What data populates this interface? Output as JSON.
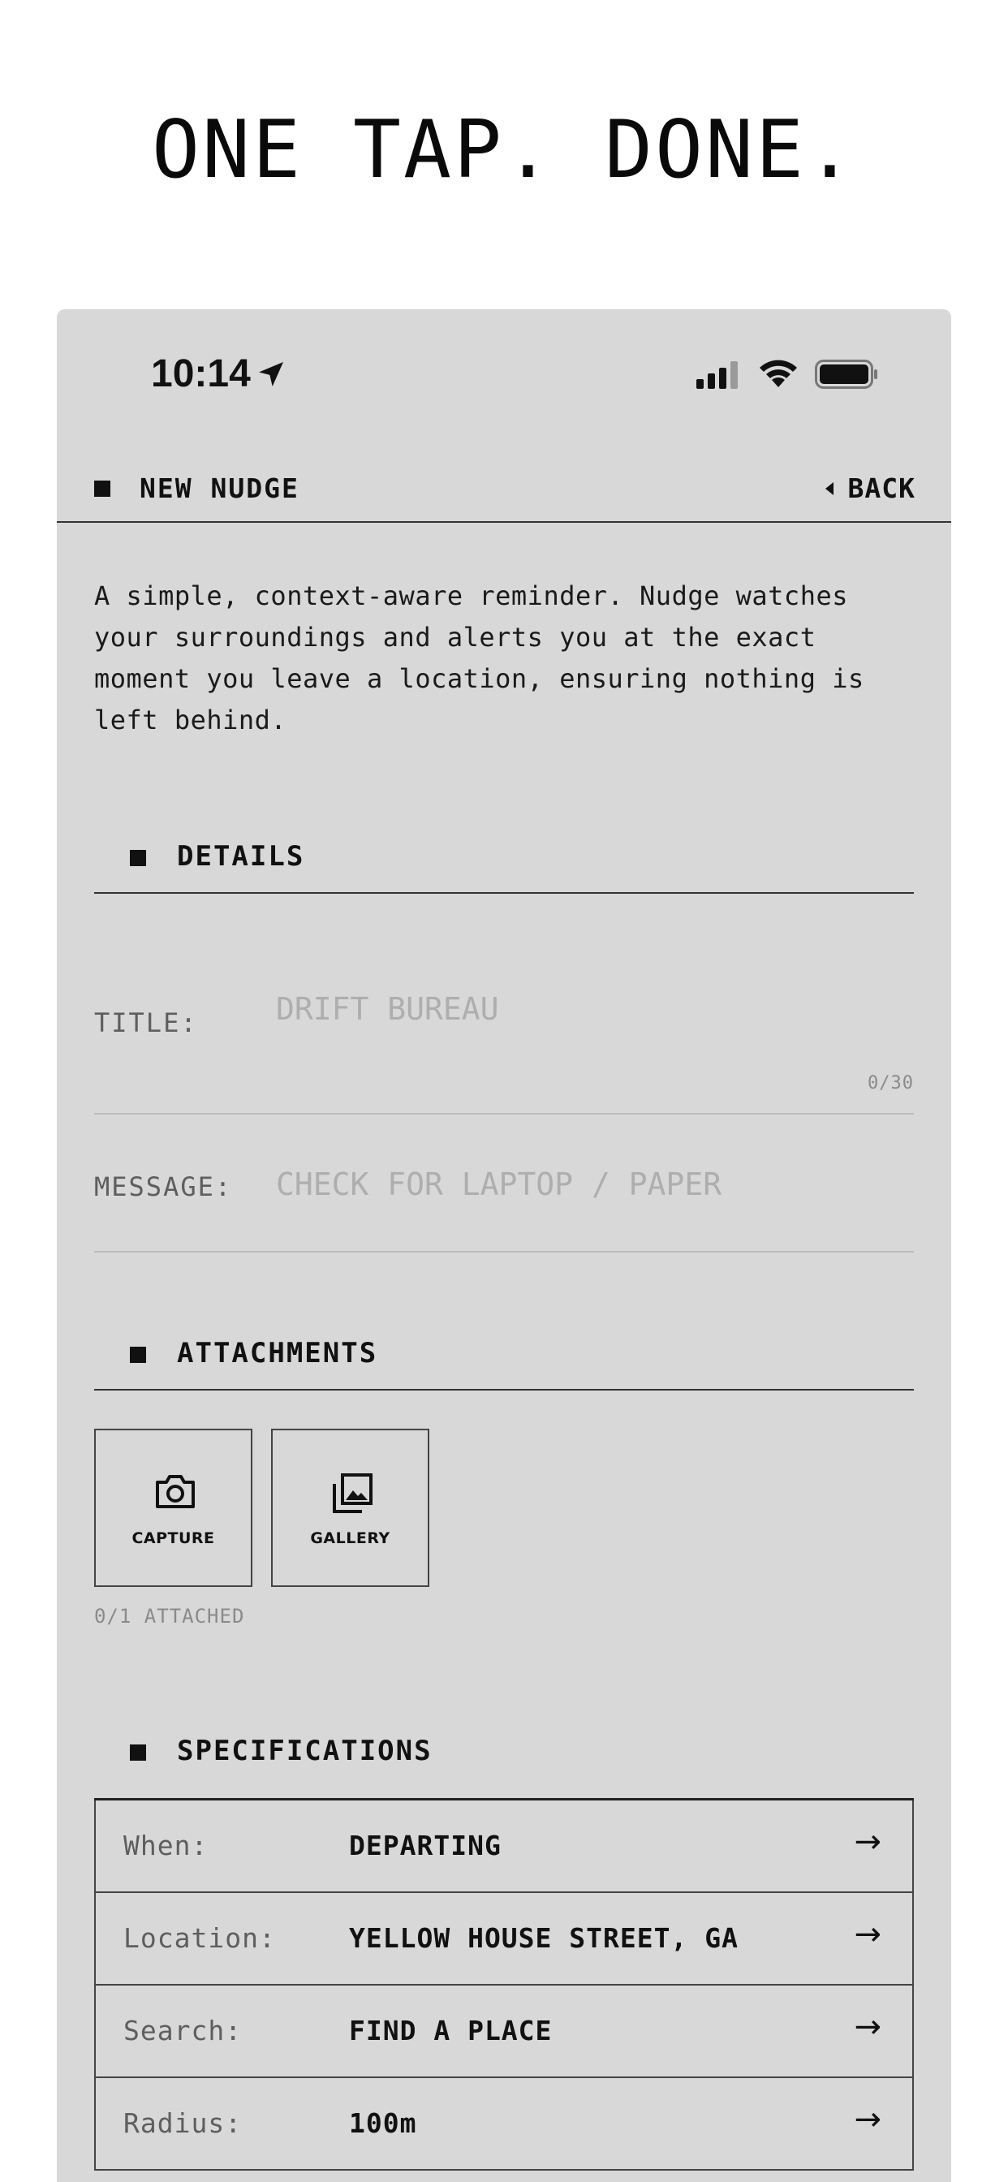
{
  "headline": "ONE TAP. DONE.",
  "status_bar": {
    "time": "10:14"
  },
  "nav": {
    "title": "NEW NUDGE",
    "back_label": "BACK"
  },
  "intro": "A simple, context-aware reminder. Nudge watches your surroundings and alerts you at the exact moment you leave a location, ensuring nothing is left behind.",
  "details": {
    "heading": "DETAILS",
    "title_label": "TITLE:",
    "title_placeholder": "DRIFT BUREAU",
    "title_counter": "0/30",
    "message_label": "MESSAGE:",
    "message_placeholder": "CHECK FOR LAPTOP / PAPER"
  },
  "attachments": {
    "heading": "ATTACHMENTS",
    "capture_label": "CAPTURE",
    "capture_icon": "camera-icon",
    "gallery_label": "GALLERY",
    "gallery_icon": "gallery-icon",
    "attached_count": "0/1 ATTACHED"
  },
  "specifications": {
    "heading": "SPECIFICATIONS",
    "rows": [
      {
        "label": "When:",
        "value": "DEPARTING"
      },
      {
        "label": "Location:",
        "value": "YELLOW HOUSE STREET, GA"
      },
      {
        "label": "Search:",
        "value": "FIND A PLACE"
      },
      {
        "label": "Radius:",
        "value": "100m"
      }
    ]
  },
  "colors": {
    "card_bg": "#d8d8d8",
    "page_bg": "#ffffff",
    "text": "#111111",
    "muted": "#5e5e5e",
    "placeholder": "#aeaeae"
  }
}
